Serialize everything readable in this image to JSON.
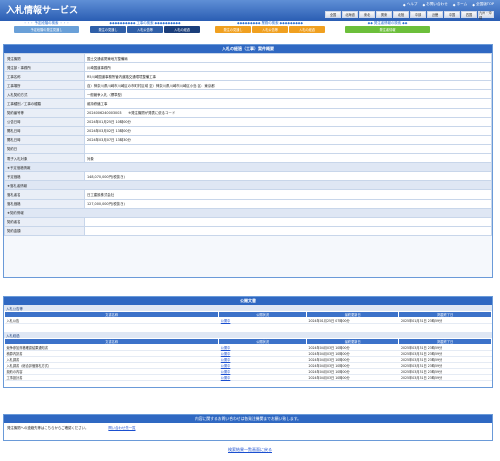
{
  "header": {
    "title": "入札情報サービス",
    "links": [
      {
        "icon": "help-icon",
        "label": "ヘルプ"
      },
      {
        "icon": "mail-icon",
        "label": "お問い合わせ"
      },
      {
        "icon": "home-icon",
        "label": "ホーム"
      },
      {
        "icon": "top-icon",
        "label": "全国版TOP"
      }
    ],
    "regions": [
      "全国",
      "北海道",
      "東北",
      "関東",
      "北陸",
      "中部",
      "近畿",
      "中国",
      "四国",
      "九州・沖縄"
    ]
  },
  "tab_groups": [
    {
      "label": "・・・ 予定段階の検索 ・・・",
      "tabs": [
        {
          "label": "予定段階の発注見通し",
          "color": "#6aa0d8"
        }
      ]
    },
    {
      "label": "◆◆◆◆◆◆◆◆◆◆ 工事の検索 ◆◆◆◆◆◆◆◆◆◆",
      "tabs": [
        {
          "label": "発注の見通し",
          "color": "#2f5fa8"
        },
        {
          "label": "入札公告等",
          "color": "#2f5fa8"
        },
        {
          "label": "入札の経過",
          "color": "#1b3e7a"
        }
      ]
    },
    {
      "label": "◆◆◆◆◆◆◆◆◆ 業務の検索 ◆◆◆◆◆◆◆◆◆",
      "tabs": [
        {
          "label": "発注の見通し",
          "color": "#f0a020"
        },
        {
          "label": "入札公告等",
          "color": "#f0a020"
        },
        {
          "label": "入札の経過",
          "color": "#f0a020"
        }
      ]
    },
    {
      "label": "◆◆ 発注者情報の検索 ◆◆",
      "tabs": [
        {
          "label": "発注者情報",
          "color": "#6cbf3b"
        }
      ]
    }
  ],
  "detail": {
    "title": "入札の経過（工事）案件概要",
    "rows": [
      {
        "label": "発注機関",
        "value": "国土交通省関東地方整備局"
      },
      {
        "label": "発注部・事務所",
        "value": "川崎国道事務所"
      },
      {
        "label": "工事名称",
        "value": "R5川崎国道事務所管内道路交通環境整備工事"
      },
      {
        "label": "工事場所",
        "value": "自）神奈川県川崎市川崎区の市町村区域 至）神奈川県川崎市川崎区小島 区：東京都"
      },
      {
        "label": "入札契約方式",
        "value": "一般競争入札（標準型）"
      },
      {
        "label": "工事種別／工事の種類",
        "value": "維持修繕工事"
      },
      {
        "label": "契約番号等",
        "value": "2024006240003003　　※発注機関が発表に依るコード"
      },
      {
        "label": "公告日時",
        "value": "2024年01月25日 10時00分"
      },
      {
        "label": "開札日時",
        "value": "2024年03月02日 13時00分"
      },
      {
        "label": "開札日時",
        "value": "2024年03月07日 13時30分"
      },
      {
        "label": "契約日",
        "value": ""
      },
      {
        "label": "電子入札対象",
        "value": "対象"
      }
    ],
    "section_yotei": "★予定価格情報",
    "rows_yotei": [
      {
        "label": "予定価格",
        "value": "148,070,000円(税抜き)"
      }
    ],
    "section_rakusatsu": "★落札者情報",
    "rows_rakusatsu": [
      {
        "label": "落札者名",
        "value": "日工建設株式会社"
      },
      {
        "label": "落札価格",
        "value": "127,000,000円(税抜き)"
      }
    ],
    "section_keiyaku": "★契約情報",
    "rows_keiyaku": [
      {
        "label": "契約者名",
        "value": ""
      },
      {
        "label": "契約金額",
        "value": ""
      }
    ]
  },
  "docs": {
    "title": "公開文書",
    "koukoku": {
      "heading": "入札公告等",
      "columns": [
        "文書名称",
        "公開状況",
        "最終更新日",
        "掲載終了日"
      ],
      "rows": [
        [
          "入札公告",
          "公開中",
          "2024年01月25日 07時00分",
          "2025年01月31日 23時59分"
        ]
      ]
    },
    "keika": {
      "heading": "入札経過",
      "columns": [
        "文書名称",
        "公開状況",
        "最終更新日",
        "掲載終了日"
      ],
      "rows": [
        [
          "競争参加資格確認結果通知書",
          "公開中",
          "2024年04月03日 10時00分",
          "2025年03月31日 23時59分"
        ],
        [
          "積算内訳書",
          "公開中",
          "2024年04月03日 10時00分",
          "2025年03月31日 23時59分"
        ],
        [
          "入札調書",
          "公開中",
          "2024年04月03日 10時00分",
          "2025年03月31日 23時59分"
        ],
        [
          "入札調書（総合評価落札方式）",
          "公開中",
          "2024年04月03日 10時00分",
          "2025年03月31日 23時59分"
        ],
        [
          "契約の内容",
          "公開中",
          "2024年04月03日 10時00分",
          "2025年03月31日 23時59分"
        ],
        [
          "工事設計書",
          "公開中",
          "2024年04月03日 10時00分",
          "2025年03月31日 23時59分"
        ]
      ]
    }
  },
  "contact": {
    "title": "内容に関するお問い合わせは各発注機関までお願い致します。",
    "text": "発注機関への連絡先等はこちらからご確認ください。",
    "link": "問い合わせ先一覧"
  },
  "back_link": "検索結果一覧画面に戻る"
}
